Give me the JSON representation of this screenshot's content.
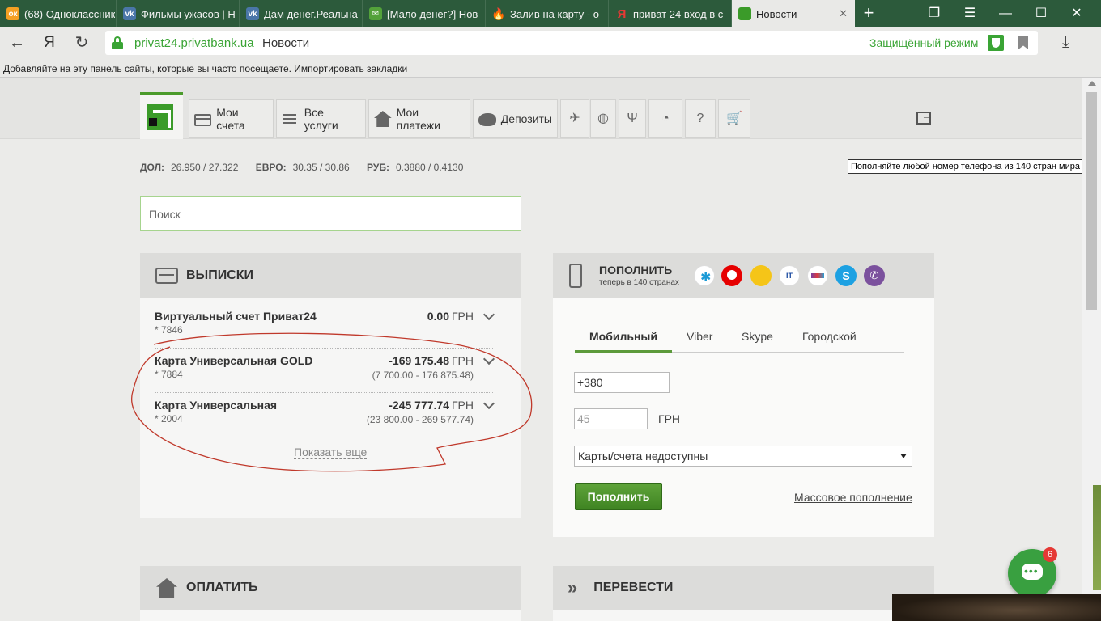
{
  "tabs": [
    {
      "title": "(68) Одноклассник",
      "fav": "ok",
      "color": "#f5a023",
      "glyph": "ок"
    },
    {
      "title": "Фильмы ужасов | Н",
      "fav": "vk",
      "color": "#4a76a8",
      "glyph": "vk"
    },
    {
      "title": "Дам денег.Реальна",
      "fav": "vk",
      "color": "#4a76a8",
      "glyph": "vk"
    },
    {
      "title": "[Мало денег?] Нов",
      "fav": "mail",
      "color": "#53a23a",
      "glyph": "✉"
    },
    {
      "title": "Залив на карту - о",
      "fav": "fire",
      "color": "#e8731b",
      "glyph": "🔥"
    },
    {
      "title": "приват 24 вход в с",
      "fav": "yandex",
      "color": "#e53935",
      "glyph": "Я"
    },
    {
      "title": "Новости",
      "fav": "privat",
      "color": "#3b9b29",
      "glyph": ""
    }
  ],
  "address": {
    "domain": "privat24.privatbank.ua",
    "page_title": "Новости",
    "protect_label": "Защищённый режим"
  },
  "bookmarks_bar_text": "Добавляйте на эту панель сайты, которые вы часто посещаете. Импортировать закладки",
  "nav": {
    "my_accounts": "Мои счета",
    "all_services": "Все услуги",
    "my_payments": "Мои платежи",
    "deposits": "Депозиты"
  },
  "tooltip": "Пополняйте любой номер телефона из 140 стран мира",
  "rates": {
    "usd_label": "ДОЛ:",
    "usd": "26.950 / 27.322",
    "eur_label": "ЕВРО:",
    "eur": "30.35 / 30.86",
    "rub_label": "РУБ:",
    "rub": "0.3880 / 0.4130"
  },
  "search": {
    "placeholder": "Поиск"
  },
  "statements": {
    "title": "ВЫПИСКИ",
    "rows": [
      {
        "name": "Виртуальный счет Приват24",
        "number": "* 7846",
        "amount": "0.00",
        "currency": "ГРН",
        "range": ""
      },
      {
        "name": "Карта Универсальная GOLD",
        "number": "* 7884",
        "amount": "-169 175.48",
        "currency": "ГРН",
        "range": "(7 700.00 - 176 875.48)"
      },
      {
        "name": "Карта Универсальная",
        "number": "* 2004",
        "amount": "-245 777.74",
        "currency": "ГРН",
        "range": "(23 800.00 - 269 577.74)"
      }
    ],
    "show_more": "Показать еще"
  },
  "topup": {
    "title": "ПОПОЛНИТЬ",
    "subtitle": "теперь в 140 странах",
    "operators": [
      {
        "name": "kyivstar-icon",
        "color": "#ffffff"
      },
      {
        "name": "vodafone-icon",
        "color": "#e60000"
      },
      {
        "name": "lifecell-icon",
        "color": "#f5c518"
      },
      {
        "name": "intertelecom-icon",
        "color": "#ffffff"
      },
      {
        "name": "trimob-icon",
        "color": "#ffffff"
      },
      {
        "name": "skype-icon",
        "color": "#1da1e2"
      },
      {
        "name": "viber-icon",
        "color": "#7b519d"
      }
    ],
    "tabs": [
      "Мобильный",
      "Viber",
      "Skype",
      "Городской"
    ],
    "active_tab": "Мобильный",
    "phone_value": "+380",
    "amount_placeholder": "45",
    "amount_currency": "ГРН",
    "card_select": "Карты/счета недоступны",
    "submit": "Пополнить",
    "mass_link": "Массовое пополнение"
  },
  "pay": {
    "title": "ОПЛАТИТЬ"
  },
  "transfer": {
    "title": "ПЕРЕВЕСТИ"
  },
  "chat": {
    "badge": "6"
  },
  "colors": {
    "brand_green": "#3b9b29",
    "tabbar": "#2c5a3b",
    "annotation_red": "#c0392b"
  }
}
